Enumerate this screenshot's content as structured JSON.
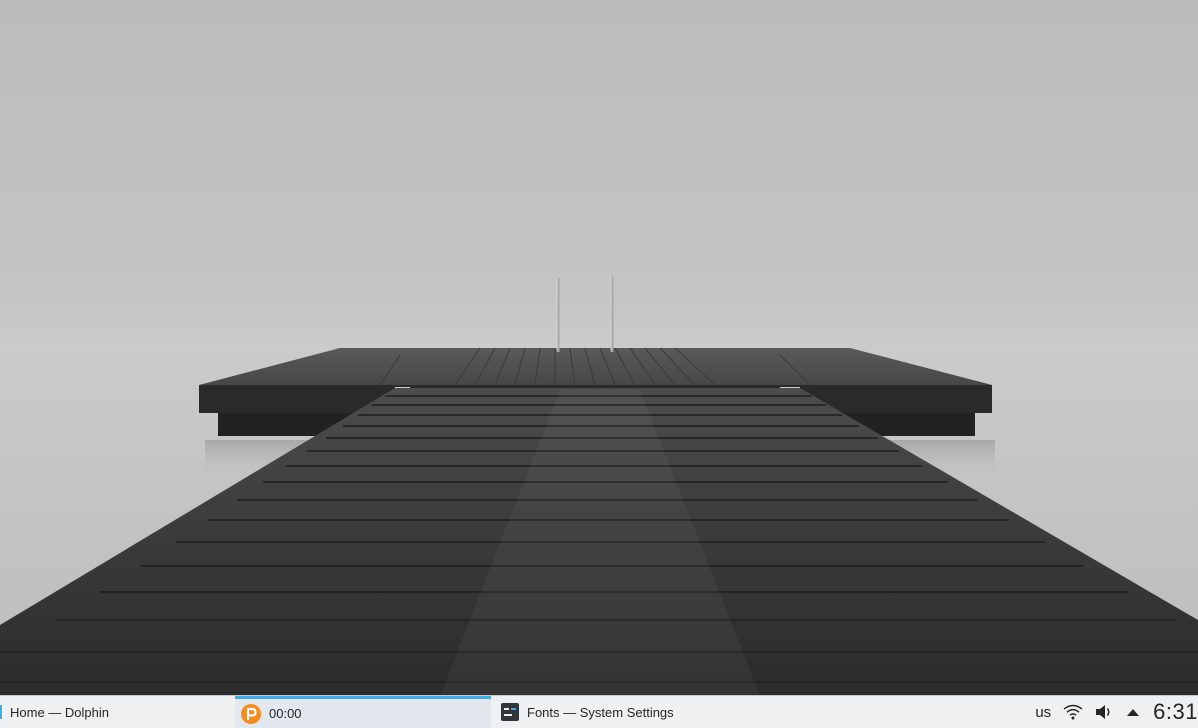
{
  "taskbar": {
    "tasks": [
      {
        "label": "Home — Dolphin",
        "icon": "dolphin-icon"
      },
      {
        "label": "00:00",
        "icon": "peek-icon"
      },
      {
        "label": "Fonts  — System Settings",
        "icon": "system-settings-icon"
      }
    ],
    "tray": {
      "keyboard_layout": "us",
      "clock": "6:31"
    }
  },
  "colors": {
    "accent": "#3daee9",
    "taskbar_bg": "#eff0f1",
    "peek_icon": "#f58a1f"
  }
}
